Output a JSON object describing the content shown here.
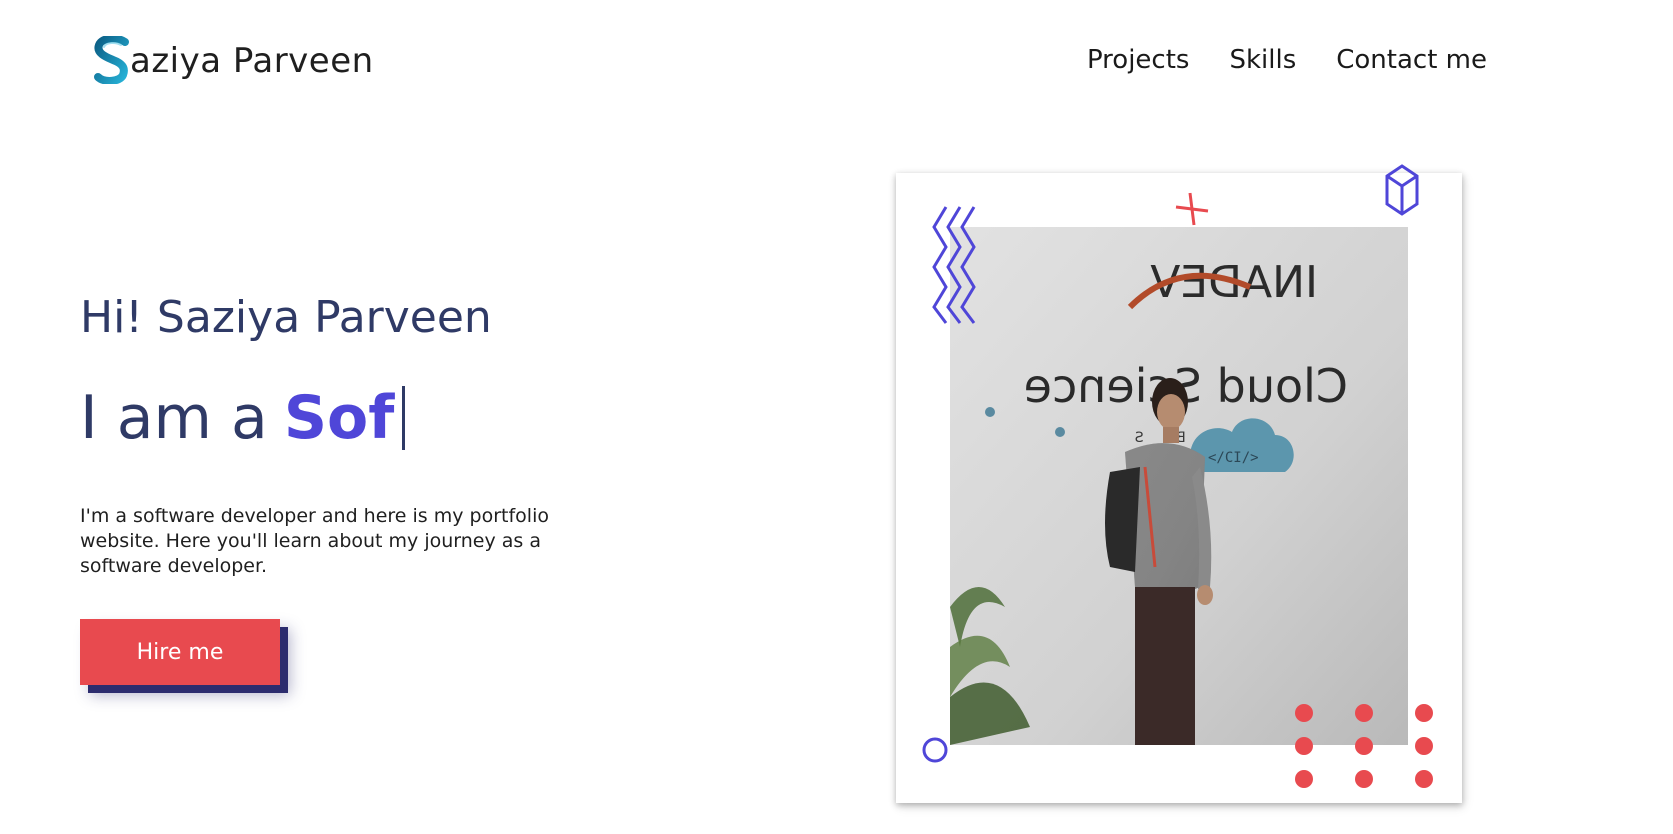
{
  "header": {
    "logo_text": "aziya Parveen",
    "logo_icon": "s-ribbon-logo",
    "nav": [
      {
        "label": "Projects"
      },
      {
        "label": "Skills"
      },
      {
        "label": "Contact me"
      }
    ]
  },
  "hero": {
    "greeting": "Hi! Saziya Parveen",
    "role_prefix": "I am a",
    "role_typed": "Sof",
    "description": "I'm a software developer and here is my portfolio website. Here you'll learn about my journey as a software developer.",
    "cta_label": "Hire me"
  },
  "photo": {
    "wall_sign_brand": "INADEV",
    "wall_sign_text": "Cloud Science",
    "wall_sign_sub": "L A B S",
    "cloud_code": "</CI/>"
  },
  "colors": {
    "accent_purple": "#4f46d8",
    "heading_navy": "#2f3a66",
    "cta_red": "#e84a4f",
    "shadow_navy": "#2c2c6e",
    "logo_teal": "#1d8fb4"
  }
}
